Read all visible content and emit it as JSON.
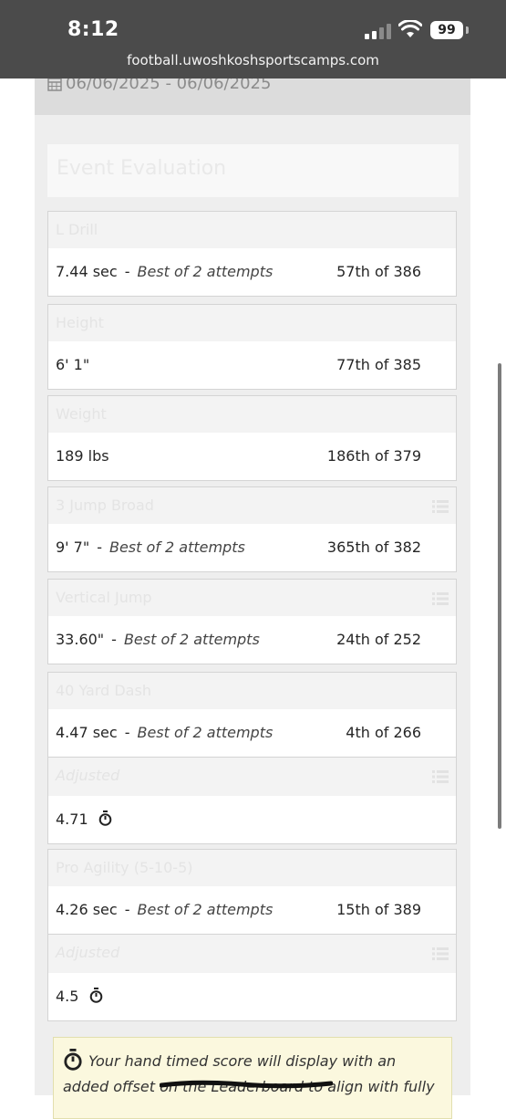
{
  "status_bar": {
    "time": "8:12",
    "battery": "99",
    "url": "football.uwoshkoshsportscamps.com"
  },
  "date_range": "06/06/2025 - 06/06/2025",
  "section_title": "Event Evaluation",
  "events": [
    {
      "name": "L Drill",
      "value": "7.44 sec",
      "best": "Best of 2 attempts",
      "rank": "57th of 386"
    },
    {
      "name": "Height",
      "value": "6' 1\"",
      "rank": "77th of 385"
    },
    {
      "name": "Weight",
      "value": "189 lbs",
      "rank": "186th of 379"
    },
    {
      "name": "3 Jump Broad",
      "value": "9' 7\"",
      "best": "Best of 2 attempts",
      "rank": "365th of 382"
    },
    {
      "name": "Vertical Jump",
      "value": "33.60\"",
      "best": "Best of 2 attempts",
      "rank": "24th of 252"
    },
    {
      "name": "40 Yard Dash",
      "value": "4.47 sec",
      "best": "Best of 2 attempts",
      "rank": "4th of 266",
      "adjusted_label": "Adjusted",
      "adjusted_value": "4.71"
    },
    {
      "name": "Pro Agility (5-10-5)",
      "value": "4.26 sec",
      "best": "Best of 2 attempts",
      "rank": "15th of 389",
      "adjusted_label": "Adjusted",
      "adjusted_value": "4.5"
    }
  ],
  "separator": "-",
  "note": "Your hand timed score will display with an added offset on the Leaderboard to align with fully",
  "icons": {
    "calendar": "calendar-icon",
    "list": "list-icon",
    "stopwatch": "stopwatch-icon"
  }
}
